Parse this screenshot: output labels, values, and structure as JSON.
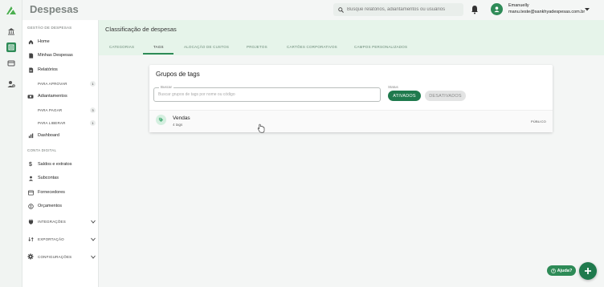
{
  "app": {
    "title": "Despesas"
  },
  "header": {
    "search_placeholder": "Busque relatórios, adiantamentos ou usuários",
    "user_name": "Emanuelly",
    "user_email": "manu.teste@sankhyadespesas.com.br"
  },
  "sidebar": {
    "section_gestao": "GESTÃO DE DESPESAS",
    "home": "Home",
    "minhas_despesas": "Minhas Despesas",
    "relatorios": "Relatórios",
    "para_aprovar": "PARA APROVAR",
    "para_aprovar_count": "1",
    "adiantamentos": "Adiantamentos",
    "para_pagar": "PARA PAGAR",
    "para_pagar_count": "3",
    "para_liberar": "PARA LIBERAR",
    "para_liberar_count": "1",
    "dashboard": "Dashboard",
    "section_conta": "CONTA DIGITAL",
    "saldos": "Saldos e extratos",
    "subcontas": "Subcontas",
    "fornecedores": "Fornecedores",
    "orcamentos": "Orçamentos",
    "integracoes": "INTEGRAÇÕES",
    "exportacao": "EXPORTAÇÃO",
    "configuracoes": "CONFIGURAÇÕES"
  },
  "main": {
    "title": "Classificação de despesas",
    "tabs": [
      "CATEGORIAS",
      "TAGS",
      "ALOCAÇÃO DE CUSTOS",
      "PROJETOS",
      "CARTÕES CORPORATIVOS",
      "CAMPOS PERSONALIZADOS"
    ],
    "active_tab": "TAGS"
  },
  "card": {
    "title": "Grupos de tags",
    "search_label": "Buscar",
    "search_placeholder": "Buscar grupos de tags por nome ou código",
    "status_label": "Status",
    "btn_active": "ATIVADOS",
    "btn_inactive": "DESATIVADOS",
    "group": {
      "name": "Vendas",
      "count": "4 tags",
      "visibility": "PÚBLICO"
    }
  },
  "help": {
    "label": "Ajuda?"
  },
  "colors": {
    "brand": "#2e8b57",
    "brand_dark": "#1f7a4d",
    "header_bg": "#e6f4ea"
  }
}
